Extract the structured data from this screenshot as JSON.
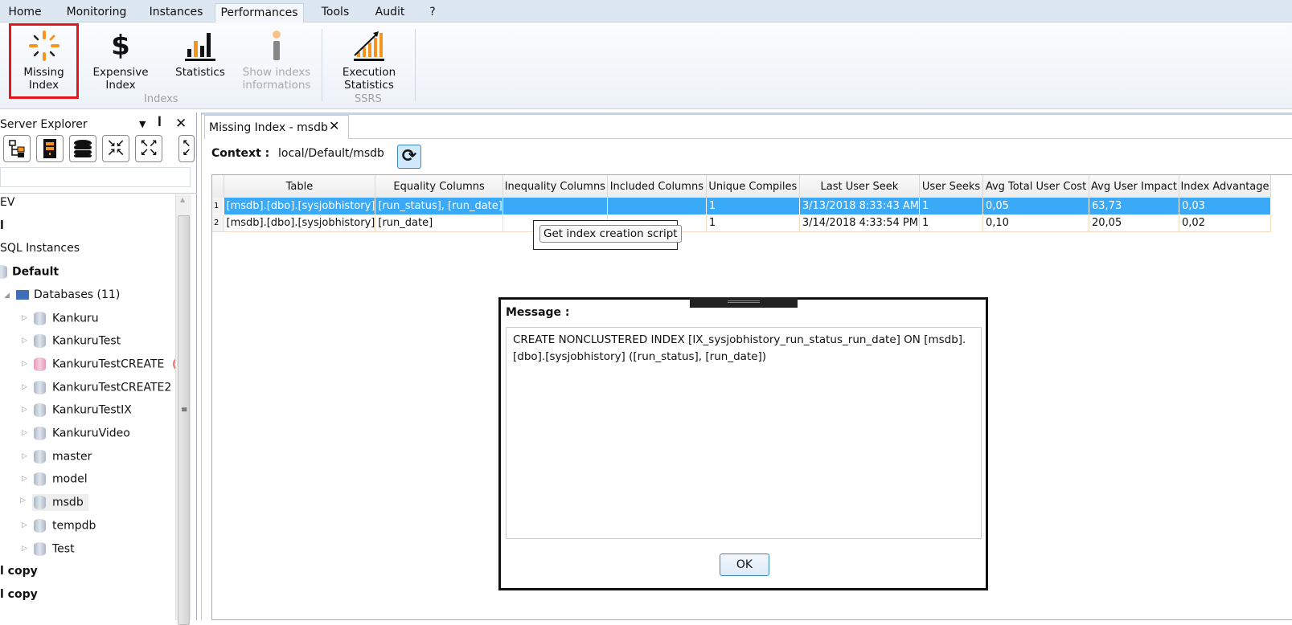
{
  "menu_tabs": [
    "Home",
    "Monitoring",
    "Instances",
    "Performances",
    "Tools",
    "Audit",
    "?"
  ],
  "active_tab": "Performances",
  "ribbon": {
    "buttons": [
      {
        "label1": "Missing",
        "label2": "Index",
        "icon": "missing-index-icon",
        "selected": true
      },
      {
        "label1": "Expensive",
        "label2": "Index",
        "icon": "dollar-icon"
      },
      {
        "label1": "Statistics",
        "label2": "",
        "icon": "bar-chart-icon"
      },
      {
        "label1": "Show indexs",
        "label2": "informations",
        "icon": "info-icon",
        "disabled": true
      },
      {
        "label1": "Execution",
        "label2": "Statistics",
        "icon": "growth-chart-icon"
      }
    ],
    "groups": [
      "Indexs",
      "SSRS"
    ]
  },
  "sidebar": {
    "title": "Server Explorer",
    "tree": [
      {
        "label": "EV",
        "level": 0
      },
      {
        "label": "l",
        "level": 0,
        "bold": true
      },
      {
        "label": "SQL Instances",
        "level": 0
      },
      {
        "label": "Default",
        "level": 0,
        "bold": true
      },
      {
        "label": "Databases (11)",
        "level": 1
      },
      {
        "label": "Kankuru",
        "level": 2
      },
      {
        "label": "KankuruTest",
        "level": 2
      },
      {
        "label": "KankuruTestCREATE",
        "level": 2,
        "note": "(C",
        "error": true
      },
      {
        "label": "KankuruTestCREATE2",
        "level": 2
      },
      {
        "label": "KankuruTestIX",
        "level": 2
      },
      {
        "label": "KankuruVideo",
        "level": 2
      },
      {
        "label": "master",
        "level": 2
      },
      {
        "label": "model",
        "level": 2
      },
      {
        "label": "msdb",
        "level": 2,
        "selected": true
      },
      {
        "label": "tempdb",
        "level": 2
      },
      {
        "label": "Test",
        "level": 2
      },
      {
        "label": "l copy",
        "level": 0,
        "bold": true
      },
      {
        "label": "l copy",
        "level": 0,
        "bold": true
      }
    ]
  },
  "document": {
    "tab_title": "Missing Index - msdb",
    "context_label": "Context :",
    "context_value": "local/Default/msdb",
    "columns": [
      "Table",
      "Equality Columns",
      "Inequality Columns",
      "Included Columns",
      "Unique Compiles",
      "Last User Seek",
      "User Seeks",
      "Avg Total User Cost",
      "Avg User Impact",
      "Index Advantage"
    ],
    "rows": [
      [
        "1",
        "[msdb].[dbo].[sysjobhistory]",
        "[run_status], [run_date]",
        "",
        "",
        "1",
        "3/13/2018 8:33:43 AM",
        "1",
        "0,05",
        "63,73",
        "0,03"
      ],
      [
        "2",
        "[msdb].[dbo].[sysjobhistory]",
        "[run_date]",
        "",
        "",
        "1",
        "3/14/2018 4:33:54 PM",
        "1",
        "0,10",
        "20,05",
        "0,02"
      ]
    ],
    "context_menu_item": "Get index creation script"
  },
  "dialog": {
    "title": "Message :",
    "text": "CREATE NONCLUSTERED INDEX [IX_sysjobhistory_run_status_run_date] ON [msdb].[dbo].[sysjobhistory] ([run_status], [run_date])",
    "ok": "OK"
  },
  "colors": {
    "accent": "#f7941d",
    "selection": "#3aa9f8",
    "highlight": "#e8141c"
  }
}
